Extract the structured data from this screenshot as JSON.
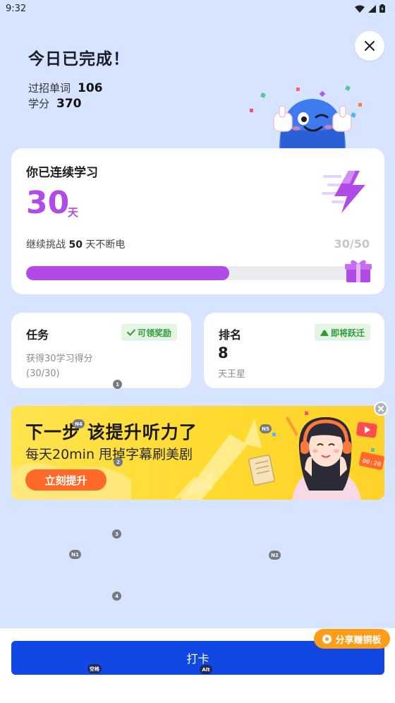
{
  "status_bar": {
    "time": "9:32"
  },
  "header": {
    "title": "今日已完成！"
  },
  "stats": [
    {
      "label": "过招单词",
      "value": "106"
    },
    {
      "label": "学分",
      "value": "370"
    }
  ],
  "streak": {
    "title": "你已连续学习",
    "days": "30",
    "unit": "天",
    "challenge_prefix": "继续挑战",
    "challenge_days": "50",
    "challenge_suffix": "天不断电",
    "progress_text": "30/50",
    "progress_fraction": 0.6,
    "accent": "#b24ae8"
  },
  "task_card": {
    "title": "任务",
    "badge": "可领奖励",
    "desc_line1": "获得30学习得分",
    "desc_line2": "(30/30)"
  },
  "rank_card": {
    "title": "排名",
    "badge": "即将跃迁",
    "value": "8",
    "subtitle": "天王星"
  },
  "banner": {
    "headline": "下一步 该提升听力了",
    "subline": "每天20min 甩掉字幕刷美剧",
    "button": "立刻提升",
    "timer": "00:20"
  },
  "hints": {
    "h1": "1",
    "h2": "2",
    "h3": "3",
    "h4": "4",
    "n1": "N1",
    "n2": "N2",
    "n4": "N4",
    "n5": "N5",
    "space": "空格",
    "alt": "Alt"
  },
  "bottom": {
    "checkin": "打卡",
    "share": "分享赚铜板",
    "button_color": "#1147e3"
  }
}
